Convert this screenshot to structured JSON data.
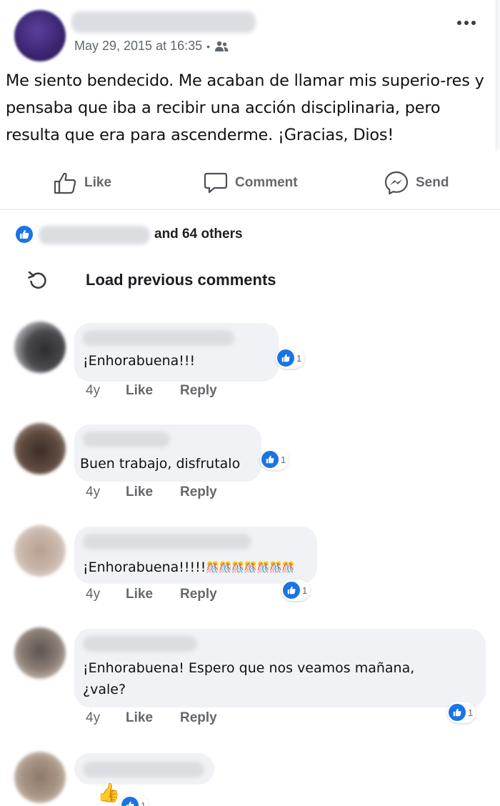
{
  "post": {
    "date": "May 29, 2015 at 16:35",
    "separator": "•",
    "audience_icon": "friends-icon",
    "more_icon": "more-options-icon",
    "text": "Me siento bendecido. Me acaban de llamar mis superio-res y pensaba que iba a recibir una acción disciplinaria, pero resulta que era para ascenderme. ¡Gracias, Dios!"
  },
  "actions": {
    "like": "Like",
    "comment": "Comment",
    "send": "Send"
  },
  "reactions": {
    "summary": "and 64 others",
    "icon": "like-icon"
  },
  "load_previous": {
    "label": "Load previous comments",
    "icon": "reload-icon"
  },
  "comments": [
    {
      "text": "¡Enhorabuena!!!",
      "reaction_count": "1",
      "age": "4y",
      "like": "Like",
      "reply": "Reply"
    },
    {
      "text": "Buen trabajo, disfrutalo",
      "reaction_count": "1",
      "age": "4y",
      "like": "Like",
      "reply": "Reply"
    },
    {
      "text": "¡Enhorabuena!!!!!",
      "emoji": "🎊🎊🎊🎊🎊🎊🎊",
      "reaction_count": "1",
      "age": "4y",
      "like": "Like",
      "reply": "Reply"
    },
    {
      "text_line1": "¡Enhorabuena! Espero que nos veamos mañana,",
      "text_line2": "¿vale?",
      "reaction_count": "1",
      "age": "4y",
      "like": "Like",
      "reply": "Reply"
    },
    {
      "emoji": "👍",
      "reaction_count": "1"
    }
  ],
  "colors": {
    "accent": "#1b74e4",
    "secondary_text": "#65676b",
    "bubble": "#f0f2f5"
  }
}
